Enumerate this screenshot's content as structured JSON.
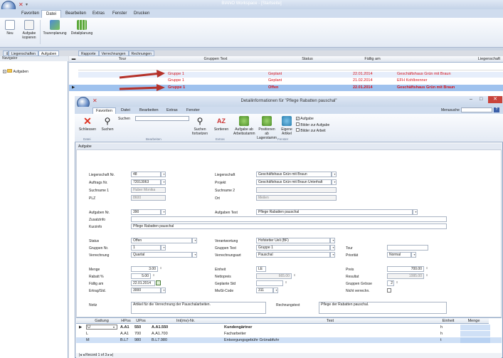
{
  "app": {
    "title": "BIANO Workspace - [Startseite]"
  },
  "menu_tabs": [
    "Favoriten",
    "Datei",
    "Bearbeiten",
    "Extras",
    "Fenster",
    "Drucken"
  ],
  "ribbon": {
    "buttons": [
      {
        "label": "Neu",
        "icon": "new-document-icon"
      },
      {
        "label": "Aufgabe kopieren",
        "icon": "copy-task-icon"
      },
      {
        "label": "Tourenplanung",
        "icon": "route-planning-icon"
      },
      {
        "label": "Detailplanung",
        "icon": "calendar-planning-icon"
      }
    ]
  },
  "left_tabs": [
    "Liegenschaften",
    "Aufgaben"
  ],
  "grid_tabs": [
    "Rapporte",
    "Verrechnungen",
    "Rechnungen"
  ],
  "navigator": {
    "title": "Navigator",
    "tree_item": "Aufgaben"
  },
  "grid": {
    "columns": [
      "Tour",
      "Gruppen Text",
      "Status",
      "Fällig am",
      "Liegenschaft"
    ],
    "rows": [
      {
        "gruppe": "Gruppe 1",
        "status": "Geplant",
        "faellig": "22.01.2014",
        "liegenschaft": "Geschäftshaus Grün mit Braun"
      },
      {
        "gruppe": "Gruppe 1",
        "status": "Geplant",
        "faellig": "21.02.2014",
        "liegenschaft": "EFH Kohlbrenner"
      },
      {
        "gruppe": "Gruppe 1",
        "status": "Offen",
        "faellig": "22.01.2014",
        "liegenschaft": "Geschäftshaus Grün mit Braun"
      }
    ]
  },
  "dialog": {
    "title": "Detailinformationen für \"Pflege Rabatten pauschal\"",
    "tabs": [
      "Favoriten",
      "Datei",
      "Bearbeiten",
      "Extras",
      "Fenster"
    ],
    "menusuche": "Menusuche",
    "ribbon": {
      "schliessen": "Schliessen",
      "suchen": "Suchen",
      "suchen_field": "Suchen",
      "suchen_fortsetzen": "Suchen fortsetzen",
      "sortieren": "Sortieren",
      "aufgabe_ab_arbeitsstamm": "Aufgabe ab Arbeitsstamm",
      "positionen_ab_lagerstamm": "Positionen ab Lagerstamm",
      "eigene_artikel": "Eigene Artikel",
      "chk_aufgabe": "Aufgabe",
      "chk_bilder_zur_aufgabe": "Bilder zur Aufgabe",
      "chk_bilder_zur_arbeit": "Bilder zur Arbeit",
      "groups": [
        "Datei",
        "Bearbeiten",
        "Extras",
        "Fenster"
      ]
    },
    "section": "Aufgabe",
    "form": {
      "liegenschaft_nr_label": "Liegenschaft Nr.",
      "liegenschaft_nr": "48",
      "auftrags_nr_label": "Auftrags Nr.",
      "auftrags_nr": "72013063",
      "suchname1_label": "Suchname 1",
      "suchname1": "Huber Monika",
      "plz_label": "PLZ",
      "plz": "8600",
      "liegenschaft_label": "Liegenschaft",
      "liegenschaft": "Geschäftshaus Grün mit Braun",
      "projekt_label": "Projekt",
      "projekt": "Geschäftshaus Grün mit Braun Unterhalt",
      "suchname2_label": "Suchname 2",
      "suchname2": "",
      "ort_label": "Ort",
      "ort": "Meilen",
      "aufgaben_nr_label": "Aufgaben Nr.",
      "aufgaben_nr": "390",
      "aufgaben_text_label": "Aufgaben Text",
      "aufgaben_text": "Pflege Rabatten pauschal",
      "zusatzinfo_label": "Zusatzinfo",
      "zusatzinfo": "",
      "kurzinfo_label": "Kurzinfo",
      "kurzinfo": "Pflege Rabatten pauschal",
      "status_label": "Status",
      "status": "Offen",
      "gruppen_nr_label": "Gruppen Nr.",
      "gruppen_nr": "1",
      "verrechnung_label": "Verrechnung",
      "verrechnung": "Quartal",
      "verantwortung_label": "Verantwortung",
      "verantwortung": "Hofstetter Ueli (BF)",
      "gruppen_text_label": "Gruppen Text",
      "gruppen_text": "Gruppe 1",
      "verrechnungsart_label": "Verrechnungsart",
      "verrechnungsart": "Pauschal",
      "tour_label": "Tour",
      "tour": "",
      "prioritaet_label": "Priorität",
      "prioritaet": "Normal",
      "menge_label": "Menge",
      "menge": "3.00",
      "rabatt_label": "Rabatt %",
      "rabatt": "5.00",
      "faellig_label": "Fällig am",
      "faellig": "22.01.2014",
      "ertrag_label": "Ertrag/Std.",
      "ertrag": "3000",
      "einheit_label": "Einheit",
      "einheit": "LE",
      "nettopreis_label": "Nettopreis",
      "nettopreis": "665.00",
      "geplante_label": "Geplante Std",
      "geplante": "",
      "mwst_label": "MwSt-Code",
      "mwst": "311",
      "preis_label": "Preis",
      "preis": "700.00",
      "resultat_label": "Resultat",
      "resultat": "1995.00",
      "gruppen_groesse_label": "Gruppen Grösse",
      "gruppen_groesse": "2",
      "nicht_label": "Nicht verrechn.",
      "notiz_label": "Notiz",
      "notiz": "Artikel für die Verrechnung der Pauschalarbeiten.",
      "rechnungstext_label": "Rechnungstext",
      "rechnungstext": "Pflege der Rabatten pauschal."
    },
    "subgrid": {
      "columns": [
        "Gattung",
        "HPos",
        "UPos",
        "Int(mv)-Nr.",
        "Text",
        "Einheit",
        "Menge"
      ],
      "rows": [
        {
          "gattung": "U",
          "hpos": "A.A1",
          "upos": "550",
          "int": "A.A1.550",
          "text": "Kundengärtner",
          "einheit": "h",
          "menge": ""
        },
        {
          "gattung": "L",
          "hpos": "A.A1",
          "upos": "700",
          "int": "A.A1.700",
          "text": "Facharbeiter",
          "einheit": "h",
          "menge": ""
        },
        {
          "gattung": "M",
          "hpos": "B.L7",
          "upos": "980",
          "int": "B.L7.980",
          "text": "Entsorgungsgebühr Grünabfuhr",
          "einheit": "t",
          "menge": ""
        }
      ]
    },
    "recordnav": "Record 1 of 3"
  }
}
